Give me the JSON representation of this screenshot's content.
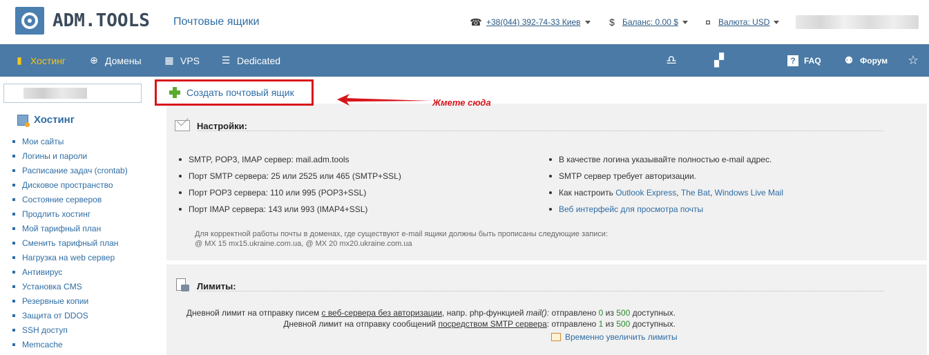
{
  "header": {
    "logo_text": "ADM.TOOLS",
    "page_title": "Почтовые ящики",
    "phone": "+38(044) 392-74-33 Киев",
    "balance": "Баланс: 0.00 $",
    "currency": "Валюта: USD"
  },
  "navbar": {
    "items": [
      {
        "label": "Хостинг",
        "icon": "server-icon",
        "active": true
      },
      {
        "label": "Домены",
        "icon": "globe-icon"
      },
      {
        "label": "VPS",
        "icon": "grid-icon"
      },
      {
        "label": "Dedicated",
        "icon": "rack-icon"
      }
    ],
    "faq": "FAQ",
    "forum": "Форум"
  },
  "sidebar": {
    "title": "Хостинг",
    "items": [
      "Мои сайты",
      "Логины и пароли",
      "Расписание задач (crontab)",
      "Дисковое пространство",
      "Состояние серверов",
      "Продлить хостинг",
      "Мой тарифный план",
      "Сменить тарифный план",
      "Нагрузка на web сервер",
      "Антивирус",
      "Установка CMS",
      "Резервные копии",
      "Защита от DDOS",
      "SSH доступ",
      "Memcache"
    ]
  },
  "main": {
    "create_button": "Создать почтовый ящик",
    "annotation": "Жмете сюда",
    "settings": {
      "title": "Настройки:",
      "left": [
        "SMTP, POP3, IMAP сервер: mail.adm.tools",
        "Порт SMTP сервера: 25 или 2525 или 465 (SMTP+SSL)",
        "Порт POP3 сервера: 110 или 995 (POP3+SSL)",
        "Порт IMAP сервера: 143 или 993 (IMAP4+SSL)"
      ],
      "right_1": "В качестве логина указывайте полностью e-mail адрес.",
      "right_2": "SMTP сервер требует авторизации.",
      "right_3_prefix": "Как настроить",
      "right_3_link1": "Outlook Express",
      "right_3_sep1": ",",
      "right_3_link2": "The Bat",
      "right_3_sep2": ",",
      "right_3_link3": "Windows Live Mail",
      "right_4": "Веб интерфейс для просмотра почты",
      "note_line1": "Для корректной работы почты в доменах, где существуют e-mail ящики должны быть прописаны следующие записи:",
      "note_line2": "@  MX  15  mx15.ukraine.com.ua, @  MX  20  mx20.ukraine.com.ua"
    },
    "limits": {
      "title": "Лимиты:",
      "line1_a": "Дневной лимит на отправку писем",
      "line1_b": "с веб-сервера без авторизации",
      "line1_c": ", напр. php-функцией",
      "line1_d": "mail():",
      "line1_e": "отправлено",
      "line1_sent": "0",
      "line1_f": "из",
      "line1_max": "500",
      "line1_g": "доступных.",
      "line2_a": "Дневной лимит на отправку сообщений",
      "line2_b": "посредством SMTP сервера",
      "line2_c": ":",
      "line2_e": "отправлено",
      "line2_sent": "1",
      "line2_f": "из",
      "line2_max": "500",
      "line2_g": "доступных.",
      "increase": "Временно увеличить лимиты"
    }
  },
  "colors": {
    "navbar": "#4a7aa5",
    "active": "#f5c518",
    "link": "#2e6da4",
    "highlight": "#d8141a"
  }
}
